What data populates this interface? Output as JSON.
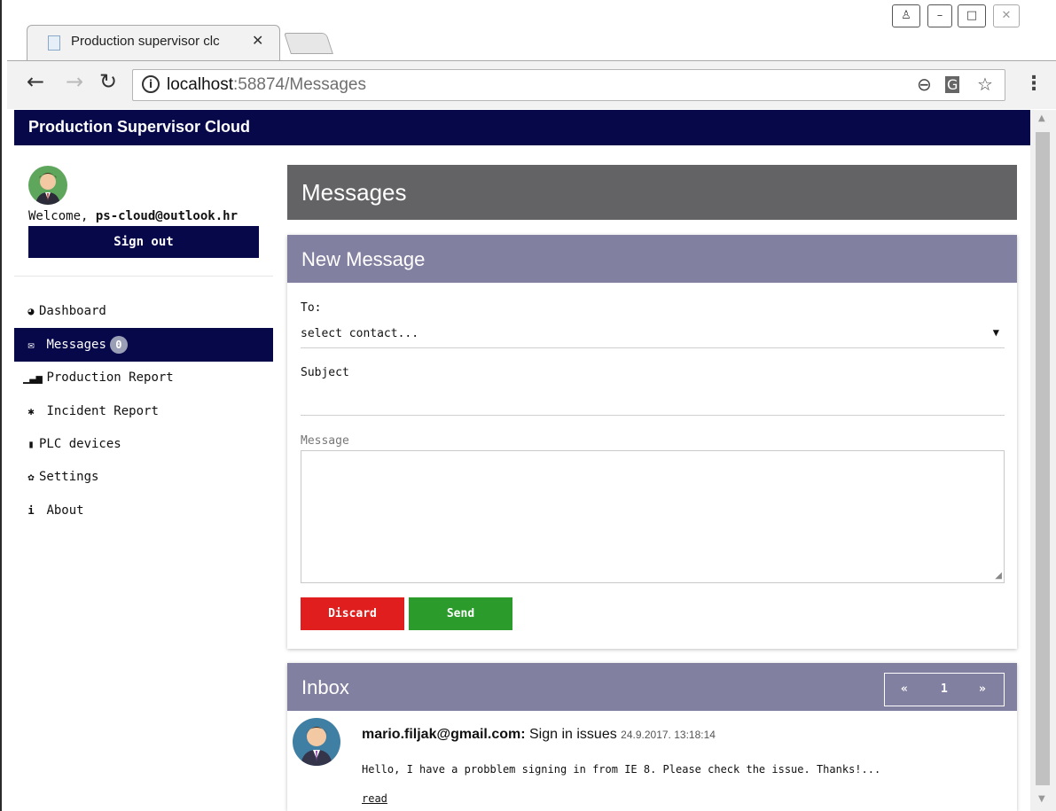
{
  "browser": {
    "tab_title": "Production supervisor clc",
    "url_host": "localhost",
    "url_path": ":58874/Messages"
  },
  "app": {
    "title": "Production Supervisor Cloud"
  },
  "sidebar": {
    "welcome_prefix": "Welcome, ",
    "user_email": "ps-cloud@outlook.hr",
    "signout_label": "Sign out",
    "items": [
      {
        "label": "Dashboard",
        "icon": "dashboard-icon"
      },
      {
        "label": "Messages",
        "icon": "envelope-icon",
        "badge": "0",
        "active": true
      },
      {
        "label": "Production Report",
        "icon": "bar-chart-icon"
      },
      {
        "label": "Incident Report",
        "icon": "bug-icon"
      },
      {
        "label": "PLC devices",
        "icon": "device-icon"
      },
      {
        "label": "Settings",
        "icon": "gear-icon"
      },
      {
        "label": "About",
        "icon": "info-icon"
      }
    ]
  },
  "main": {
    "page_title": "Messages",
    "new_message": {
      "heading": "New Message",
      "to_label": "To:",
      "to_value": "select contact...",
      "subject_label": "Subject",
      "message_label": "Message",
      "discard_label": "Discard",
      "send_label": "Send"
    },
    "inbox": {
      "heading": "Inbox",
      "pager": {
        "prev": "«",
        "page": "1",
        "next": "»"
      },
      "messages": [
        {
          "from": "mario.filjak@gmail.com:",
          "subject": "Sign in issues",
          "date": "24.9.2017. 13:18:14",
          "body": "Hello, I have a probblem signing in from IE 8. Please check the issue. Thanks!...",
          "read_label": "read"
        }
      ]
    }
  },
  "colors": {
    "header_navy": "#07084a",
    "card_header": "#8280a0",
    "title_bar": "#636366",
    "discard_red": "#e01e1e",
    "send_green": "#2b9b2b"
  }
}
